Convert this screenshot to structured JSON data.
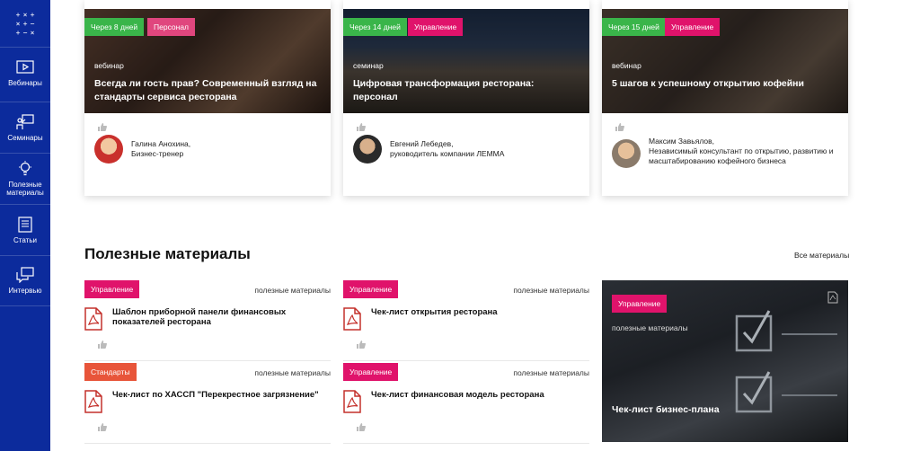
{
  "brand": {
    "logo_glyphs": [
      "+",
      "×",
      "+",
      "×",
      "+",
      "−",
      "+",
      "−",
      "×"
    ],
    "accent": "#0c2b9c"
  },
  "sidebar": {
    "items": [
      {
        "label": "Вебинары",
        "icon": "play-icon"
      },
      {
        "label": "Семинары",
        "icon": "presentation-icon"
      },
      {
        "label": "Полезные материалы",
        "icon": "lightbulb-icon"
      },
      {
        "label": "Статьи",
        "icon": "article-icon"
      },
      {
        "label": "Интервью",
        "icon": "chat-icon"
      }
    ]
  },
  "events": [
    {
      "when": "Через 8 дней",
      "category": "Персонал",
      "type": "вебинар",
      "title": "Всегда ли гость прав? Современный взгляд на стандарты сервиса ресторана",
      "author_name": "Галина Анохина,",
      "author_role": "Бизнес-тренер"
    },
    {
      "when": "Через 14 дней",
      "category": "Управление",
      "type": "семинар",
      "title": "Цифровая трансформация ресторана: персонал",
      "author_name": "Евгений Лебедев,",
      "author_role": "руководитель компании ЛЕММА"
    },
    {
      "when": "Через 15 дней",
      "category": "Управление",
      "type": "вебинар",
      "title": "5 шагов к успешному открытию кофейни",
      "author_name": "Максим Завьялов,",
      "author_role": "Независимый консультант по открытию, развитию и масштабированию кофейного бизнеса"
    }
  ],
  "materials": {
    "title": "Полезные материалы",
    "all_link": "Все материалы",
    "items": [
      {
        "category": "Управление",
        "kind": "полезные материалы",
        "title": "Шаблон приборной панели финансовых показателей ресторана"
      },
      {
        "category": "Управление",
        "kind": "полезные материалы",
        "title": "Чек-лист открытия ресторана"
      },
      {
        "category": "Стандарты",
        "kind": "полезные материалы",
        "title": "Чек-лист по ХАССП \"Перекрестное загрязнение\""
      },
      {
        "category": "Управление",
        "kind": "полезные материалы",
        "title": "Чек-лист финансовая модель ресторана"
      }
    ],
    "feature": {
      "category": "Управление",
      "kind": "полезные материалы",
      "title": "Чек-лист бизнес-плана"
    }
  }
}
